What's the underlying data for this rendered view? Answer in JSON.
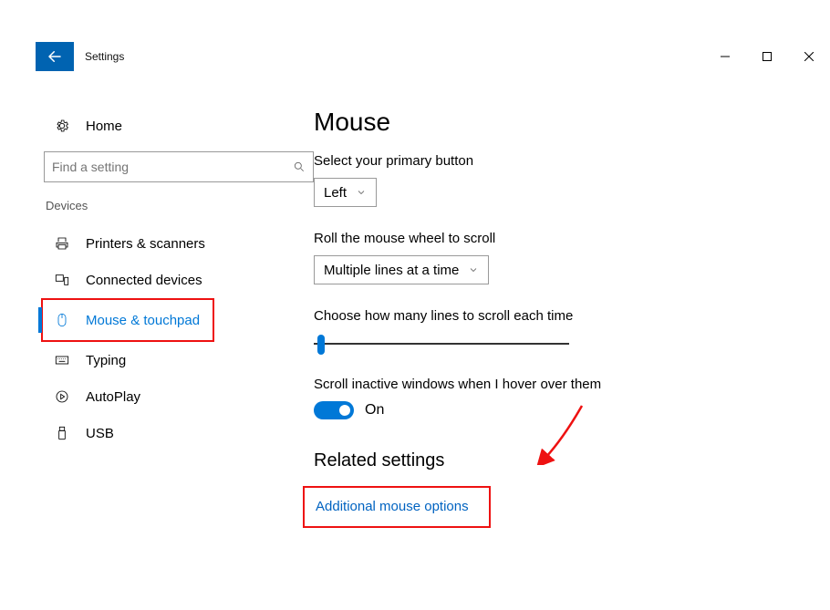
{
  "titlebar": {
    "app": "Settings"
  },
  "sidebar": {
    "home": "Home",
    "search_placeholder": "Find a setting",
    "category": "Devices",
    "items": [
      {
        "label": "Printers & scanners"
      },
      {
        "label": "Connected devices"
      },
      {
        "label": "Mouse & touchpad"
      },
      {
        "label": "Typing"
      },
      {
        "label": "AutoPlay"
      },
      {
        "label": "USB"
      }
    ]
  },
  "main": {
    "heading": "Mouse",
    "primary_btn_label": "Select your primary button",
    "primary_btn_value": "Left",
    "wheel_label": "Roll the mouse wheel to scroll",
    "wheel_value": "Multiple lines at a time",
    "lines_label": "Choose how many lines to scroll each time",
    "inactive_label": "Scroll inactive windows when I hover over them",
    "inactive_state": "On",
    "related_heading": "Related settings",
    "related_link": "Additional mouse options"
  }
}
